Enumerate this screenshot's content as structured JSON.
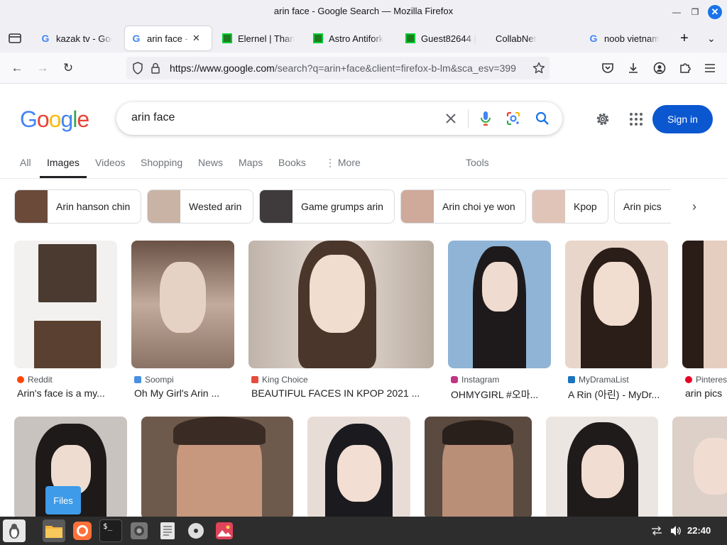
{
  "window": {
    "title": "arin face - Google Search — Mozilla Firefox"
  },
  "tabs": [
    {
      "label": "kazak tv - Goo",
      "favicon": "google-icon",
      "active": false
    },
    {
      "label": "arin face - G",
      "favicon": "google-icon",
      "active": true
    },
    {
      "label": "Elernel | Than",
      "favicon": "green-game-icon",
      "active": false
    },
    {
      "label": "Astro Antifork",
      "favicon": "green-game-icon",
      "active": false
    },
    {
      "label": "Guest82644 |",
      "favicon": "green-game-icon",
      "active": false
    },
    {
      "label": "CollabNet",
      "favicon": "",
      "active": false
    },
    {
      "label": "noob vietnam",
      "favicon": "google-icon",
      "active": false
    }
  ],
  "navbar": {
    "url_host": "https://www.google.com",
    "url_rest": "/search?q=arin+face&client=firefox-b-lm&sca_esv=399"
  },
  "google": {
    "logo": [
      "G",
      "o",
      "o",
      "g",
      "l",
      "e"
    ],
    "query": "arin face",
    "signin_label": "Sign in",
    "tabs": [
      "All",
      "Images",
      "Videos",
      "Shopping",
      "News",
      "Maps",
      "Books",
      "More",
      "Tools"
    ],
    "active_tab": "Images",
    "chips": [
      {
        "label": "Arin hanson chin",
        "thumb": "#6b4a3a"
      },
      {
        "label": "Wested arin",
        "thumb": "#c9b3a4"
      },
      {
        "label": "Game grumps arin",
        "thumb": "#3f3a3c"
      },
      {
        "label": "Arin choi ye won",
        "thumb": "#cfa99a"
      },
      {
        "label": "Kpop",
        "thumb": "#e1c4b8"
      },
      {
        "label": "Arin pics",
        "thumb": ""
      }
    ],
    "results_row1": [
      {
        "source": "Reddit",
        "source_color": "#ff4500",
        "title": "Arin's face is a my...",
        "img": "#e9e5e2",
        "img2": "#4a3a30"
      },
      {
        "source": "Soompi",
        "source_color": "#4a90e2",
        "title": "Oh My Girl's Arin ...",
        "img": "#a58f82",
        "img2": "#3b2a22"
      },
      {
        "source": "King Choice",
        "source_color": "#e74c3c",
        "title": "BEAUTIFUL FACES IN KPOP 2021 ...",
        "img": "#c8b8ad",
        "img2": "#5c4638"
      },
      {
        "source": "Instagram",
        "source_color": "#c13584",
        "title": "OHMYGIRL #오마...",
        "img": "#8fb4d6",
        "img2": "#1b1b1f"
      },
      {
        "source": "MyDramaList",
        "source_color": "#1e73be",
        "title": "A Rin (아린) - MyDr...",
        "img": "#d9c3b4",
        "img2": "#2b1d18"
      },
      {
        "source": "Pinterest",
        "source_color": "#e60023",
        "title": "arin pics",
        "img": "#e5cdbf",
        "img2": "#2a1c17"
      }
    ],
    "results_row2": [
      {
        "img": "#c9c3c0",
        "img2": "#1e1a19"
      },
      {
        "img": "#6e5a4d",
        "img2": "#3a2c24"
      },
      {
        "img": "#e8ddd6",
        "img2": "#1b1b1f"
      },
      {
        "img": "#5a4a40",
        "img2": "#2a201b"
      },
      {
        "img": "#ece6e2",
        "img2": "#1f1b1b"
      },
      {
        "img": "#dcd0c8",
        "img2": "#3b2d26"
      }
    ]
  },
  "taskbar": {
    "files_tooltip": "Files",
    "clock": "22:40"
  }
}
